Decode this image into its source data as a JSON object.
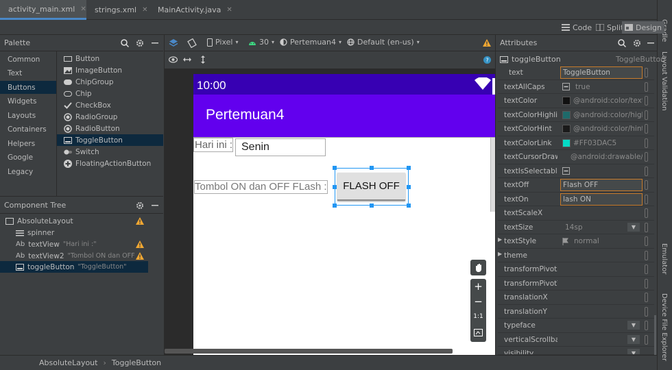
{
  "tabs": [
    {
      "label": "activity_main.xml",
      "icon": "layout-xml-icon"
    },
    {
      "label": "strings.xml",
      "icon": "values-xml-icon"
    },
    {
      "label": "MainActivity.java",
      "icon": "java-class-icon"
    }
  ],
  "right_strip": {
    "gradle": "Gradle",
    "layout_validation": "Layout Validation",
    "emulator": "Emulator",
    "device_file_explorer": "Device File Explorer"
  },
  "view_modes": {
    "code": "Code",
    "split": "Split",
    "design": "Design"
  },
  "palette": {
    "title": "Palette",
    "categories": [
      "Common",
      "Text",
      "Buttons",
      "Widgets",
      "Layouts",
      "Containers",
      "Helpers",
      "Google",
      "Legacy"
    ],
    "selected_category": "Buttons",
    "items": [
      "Button",
      "ImageButton",
      "ChipGroup",
      "Chip",
      "CheckBox",
      "RadioGroup",
      "RadioButton",
      "ToggleButton",
      "Switch",
      "FloatingActionButton"
    ],
    "selected_item": "ToggleButton"
  },
  "design_toolbar": {
    "device": "Pixel",
    "api": "30",
    "theme": "Pertemuan4",
    "locale": "Default (en-us)"
  },
  "component_tree": {
    "title": "Component Tree",
    "root": "AbsoluteLayout",
    "children": [
      {
        "prefix": "",
        "name": "spinner",
        "hint": ""
      },
      {
        "prefix": "Ab",
        "name": "textView",
        "hint": "\"Hari ini :\""
      },
      {
        "prefix": "Ab",
        "name": "textView2",
        "hint": "\"Tombol ON dan OFF ..."
      },
      {
        "prefix": "",
        "name": "toggleButton",
        "hint": "\"ToggleButton\""
      }
    ]
  },
  "phone": {
    "time": "10:00",
    "app_title": "Pertemuan4",
    "label1": "Hari ini :",
    "spinner_value": "Senin",
    "label2": "Tombol ON dan OFF FLash :",
    "toggle_text": "FLASH OFF",
    "zoom_ratio": "1:1"
  },
  "attributes": {
    "title": "Attributes",
    "component": "toggleButton",
    "component_type": "ToggleButton",
    "rows": [
      {
        "name": "text",
        "value": "ToggleButton"
      },
      {
        "name": "textAllCaps",
        "value": "true"
      },
      {
        "name": "textColor",
        "value": "@android:color/text_c",
        "color": "#111111"
      },
      {
        "name": "textColorHighli...",
        "value": "@android:color/highl",
        "color": "#1e6a6a"
      },
      {
        "name": "textColorHint",
        "value": "@android:color/hint_f",
        "color": "#1a1a1a"
      },
      {
        "name": "textColorLink",
        "value": "#FF03DAC5",
        "color": "#03dac5"
      },
      {
        "name": "textCursorDraw...",
        "value": "@android:drawable/te"
      },
      {
        "name": "textIsSelectable",
        "value": ""
      },
      {
        "name": "textOff",
        "value": "Flash OFF"
      },
      {
        "name": "textOn",
        "value": "lash ON"
      },
      {
        "name": "textScaleX",
        "value": ""
      },
      {
        "name": "textSize",
        "value": "14sp"
      },
      {
        "name": "textStyle",
        "value": "normal"
      },
      {
        "name": "theme",
        "value": ""
      },
      {
        "name": "transformPivotX",
        "value": ""
      },
      {
        "name": "transformPivotY",
        "value": ""
      },
      {
        "name": "translationX",
        "value": ""
      },
      {
        "name": "translationY",
        "value": ""
      },
      {
        "name": "typeface",
        "value": ""
      },
      {
        "name": "verticalScrollbar...",
        "value": ""
      },
      {
        "name": "visibility",
        "value": ""
      }
    ]
  },
  "breadcrumb": [
    "AbsoluteLayout",
    "ToggleButton"
  ],
  "colors": {
    "status_bar": "#3700b3",
    "app_bar": "#6200ee",
    "selection": "#2196f3",
    "warning": "#f0a732",
    "accent_tab": "#4a88c7"
  }
}
